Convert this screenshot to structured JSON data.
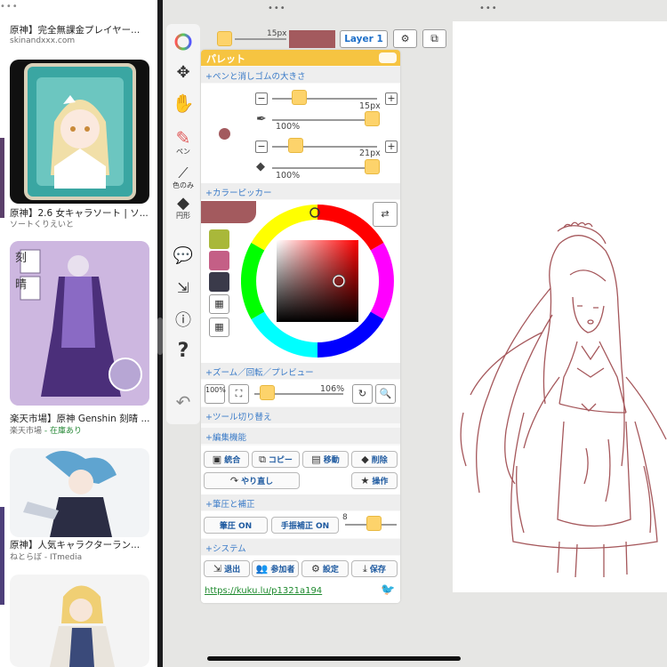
{
  "left_pane": {
    "dots": "•••",
    "results": [
      {
        "title": "原神】完全無課金プレイヤー...",
        "source": "skinandxxx.com"
      },
      {
        "title": "原神】2.6 女キャラソート | ソ...",
        "source": "ソートくりえいと"
      },
      {
        "title": "楽天市場】原神 Genshin 刻晴 ...",
        "source": "楽天市場",
        "stock": " - 在庫あり"
      },
      {
        "title": "原神】人気キャラクターラン...",
        "source": "ねとらぼ - ITmedia"
      }
    ],
    "cloth_label_1": "刻",
    "cloth_label_2": "晴"
  },
  "app": {
    "dots": "•••",
    "top": {
      "brush_size": "15px",
      "layer_label": "Layer 1",
      "color": "#a35a5e"
    },
    "toolbar": [
      {
        "icon": "color-wheel-icon",
        "label": ""
      },
      {
        "icon": "move-icon",
        "label": ""
      },
      {
        "icon": "hand-icon",
        "label": ""
      },
      {
        "icon": "pen-icon",
        "label": "ペン"
      },
      {
        "icon": "eyedropper-icon",
        "label": "色のみ"
      },
      {
        "icon": "eraser-icon",
        "label": "円形"
      },
      {
        "icon": "chat-icon",
        "label": ""
      },
      {
        "icon": "exit-icon",
        "label": ""
      },
      {
        "icon": "info-icon",
        "label": ""
      },
      {
        "icon": "help-icon",
        "label": ""
      },
      {
        "icon": "undo-icon",
        "label": ""
      }
    ],
    "palette": {
      "title": "パレット",
      "sections": {
        "pen_eraser": "+ペンと消しゴムの大きさ",
        "color_picker": "+カラーピッカー",
        "zoom": "+ズーム／回転／プレビュー",
        "tool_switch": "+ツール切り替え",
        "edit": "+編集機能",
        "pressure": "+筆圧と補正",
        "system": "+システム"
      },
      "pen": {
        "size": "15px",
        "opacity": "100%"
      },
      "eraser": {
        "size": "21px",
        "opacity": "100%"
      },
      "current_color": "#a35a5e",
      "swatches": [
        "#a9b83a",
        "#c45f86",
        "#3a3a4a"
      ],
      "zoom": {
        "reset": "100%",
        "value": "106%"
      },
      "edit_buttons": [
        "統合",
        "コピー",
        "移動",
        "削除"
      ],
      "redo": "やり直し",
      "operation": "操作",
      "pressure_on": "筆圧 ON",
      "stabilizer_on": "手振補正 ON",
      "stabilizer_value": "8",
      "system_buttons": [
        "退出",
        "参加者",
        "設定",
        "保存"
      ],
      "link": "https://kuku.lu/p1321a194"
    }
  }
}
